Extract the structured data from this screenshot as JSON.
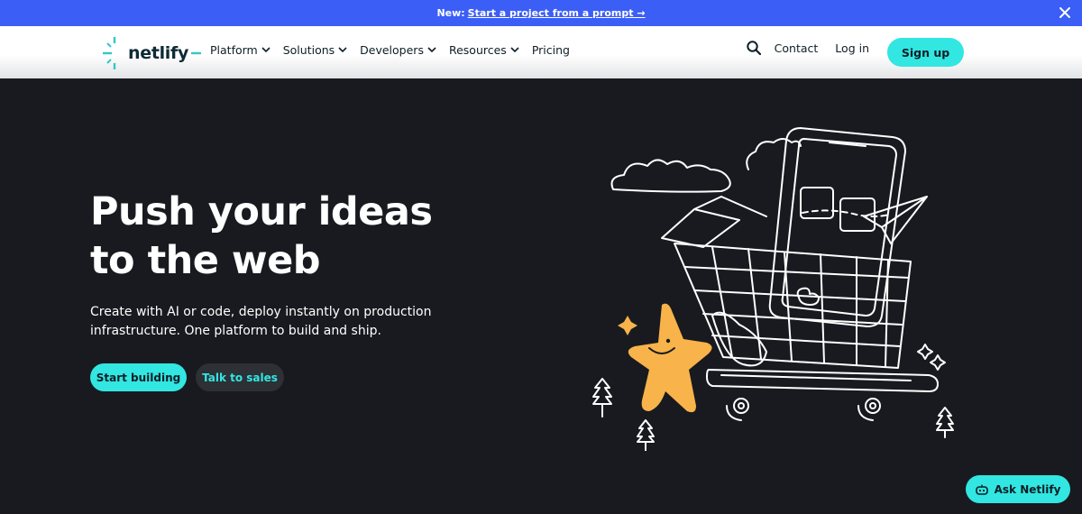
{
  "banner": {
    "prefix": "New:",
    "link_text": "Start a project from a prompt →"
  },
  "header": {
    "logo_text": "netlify",
    "nav": [
      {
        "label": "Platform",
        "has_dropdown": true
      },
      {
        "label": "Solutions",
        "has_dropdown": true
      },
      {
        "label": "Developers",
        "has_dropdown": true
      },
      {
        "label": "Resources",
        "has_dropdown": true
      },
      {
        "label": "Pricing",
        "has_dropdown": false
      }
    ],
    "contact": "Contact",
    "login": "Log in",
    "signup": "Sign up"
  },
  "hero": {
    "title_line1": "Push your ideas",
    "title_line2": "to the web",
    "subtitle": "Create with AI or code, deploy instantly on production infrastructure. One platform to build and ship.",
    "primary_cta": "Start building",
    "secondary_cta": "Talk to sales"
  },
  "chat": {
    "label": "Ask Netlify"
  },
  "colors": {
    "banner_bg": "#3b5ef6",
    "accent": "#32e6e2",
    "hero_bg": "#181a1f",
    "star_mascot": "#f8b34a"
  },
  "icons": [
    "close-icon",
    "netlify-logo-icon",
    "chevron-down-icon",
    "search-icon",
    "chat-bot-icon"
  ]
}
